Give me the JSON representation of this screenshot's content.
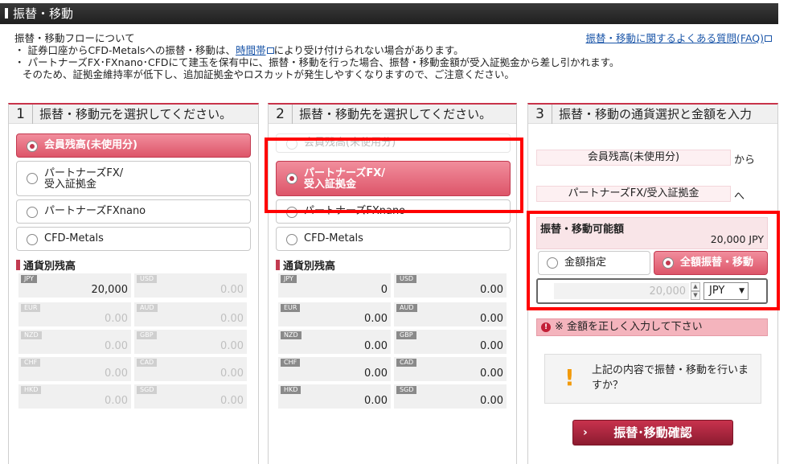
{
  "page_title": "振替・移動",
  "info": {
    "flow_link": "振替・移動フローについて",
    "faq_link": "振替・移動に関するよくある質問(FAQ)",
    "note1_pre": "・ 証券口座からCFD-Metalsへの振替・移動は、",
    "note1_link": "時間帯",
    "note1_post": "により受け付けられない場合があります。",
    "note2": "・ パートナーズFX･FXnano･CFDにて建玉を保有中に、振替・移動を行った場合、振替・移動金額が受入証拠金から差し引かれます。",
    "note3": "そのため、証拠金維持率が低下し、追加証拠金やロスカットが発生しやすくなりますので、ご注意ください。"
  },
  "step1": {
    "num": "1",
    "heading": "振替・移動元を選択してください。",
    "options": [
      {
        "label": "会員残高(未使用分)"
      },
      {
        "line1": "パートナーズFX/",
        "line2": "受入証拠金"
      },
      {
        "label": "パートナーズFXnano"
      },
      {
        "label": "CFD-Metals"
      }
    ],
    "balance_title": "通貨別残高",
    "balances": [
      {
        "cur": "JPY",
        "amt": "20,000"
      },
      {
        "cur": "USD",
        "amt": "0.00"
      },
      {
        "cur": "EUR",
        "amt": "0.00"
      },
      {
        "cur": "AUD",
        "amt": "0.00"
      },
      {
        "cur": "NZD",
        "amt": "0.00"
      },
      {
        "cur": "GBP",
        "amt": "0.00"
      },
      {
        "cur": "CHF",
        "amt": "0.00"
      },
      {
        "cur": "CAD",
        "amt": "0.00"
      },
      {
        "cur": "HKD",
        "amt": "0.00"
      },
      {
        "cur": "SGD",
        "amt": "0.00"
      }
    ]
  },
  "step2": {
    "num": "2",
    "heading": "振替・移動先を選択してください。",
    "options": [
      {
        "label": "会員残高(未使用分)"
      },
      {
        "line1": "パートナーズFX/",
        "line2": "受入証拠金"
      },
      {
        "label": "パートナーズFXnano"
      },
      {
        "label": "CFD-Metals"
      }
    ],
    "balance_title": "通貨別残高",
    "balances": [
      {
        "cur": "JPY",
        "amt": "0"
      },
      {
        "cur": "USD",
        "amt": "0.00"
      },
      {
        "cur": "EUR",
        "amt": "0.00"
      },
      {
        "cur": "AUD",
        "amt": "0.00"
      },
      {
        "cur": "NZD",
        "amt": "0.00"
      },
      {
        "cur": "GBP",
        "amt": "0.00"
      },
      {
        "cur": "CHF",
        "amt": "0.00"
      },
      {
        "cur": "CAD",
        "amt": "0.00"
      },
      {
        "cur": "HKD",
        "amt": "0.00"
      },
      {
        "cur": "SGD",
        "amt": "0.00"
      }
    ]
  },
  "step3": {
    "num": "3",
    "heading": "振替・移動の通貨選択と金額を入力",
    "from_account": "会員残高(未使用分)",
    "from_suffix": "から",
    "to_account": "パートナーズFX/受入証拠金",
    "to_suffix": "へ",
    "available_label": "振替・移動可能額",
    "available_value": "20,000 JPY",
    "mode_amount": "金額指定",
    "mode_all": "全額振替・移動",
    "amount_value": "20,000",
    "currency": "JPY",
    "error": "※ 金額を正しく入力して下さい",
    "confirm_text": "上記の内容で振替・移動を行いますか？",
    "confirm_button": "振替･移動確認"
  },
  "colors": {
    "accent": "#c8334a",
    "highlight": "#ff0000",
    "warning": "#f29a0a"
  }
}
